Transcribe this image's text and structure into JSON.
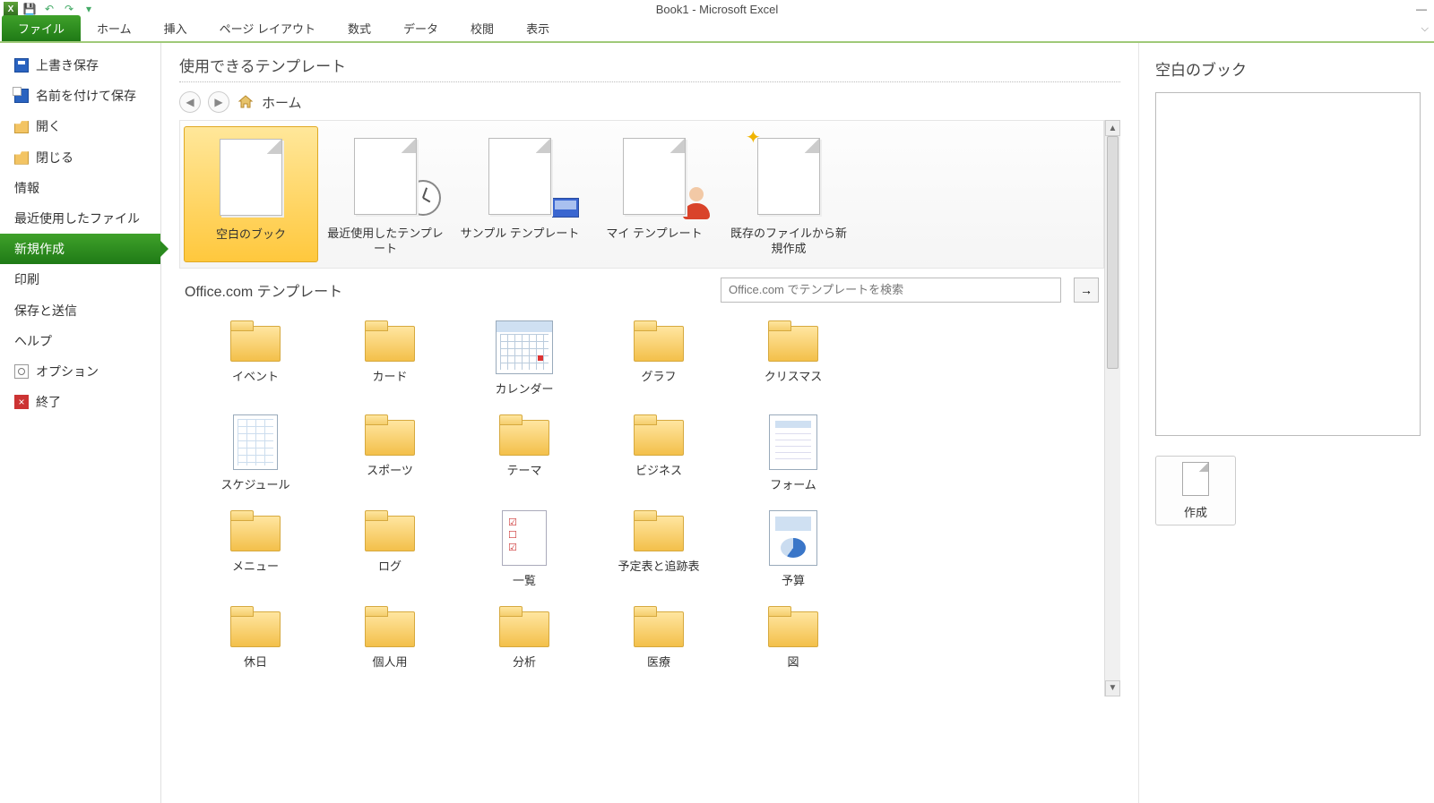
{
  "window": {
    "title": "Book1 - Microsoft Excel"
  },
  "ribbon": {
    "file": "ファイル",
    "tabs": [
      "ホーム",
      "挿入",
      "ページ レイアウト",
      "数式",
      "データ",
      "校閲",
      "表示"
    ]
  },
  "sidebar": {
    "items": [
      {
        "label": "上書き保存",
        "icon": "save"
      },
      {
        "label": "名前を付けて保存",
        "icon": "saveas"
      },
      {
        "label": "開く",
        "icon": "open"
      },
      {
        "label": "閉じる",
        "icon": "close"
      },
      {
        "label": "情報"
      },
      {
        "label": "最近使用したファイル"
      },
      {
        "label": "新規作成",
        "selected": true
      },
      {
        "label": "印刷"
      },
      {
        "label": "保存と送信"
      },
      {
        "label": "ヘルプ"
      },
      {
        "label": "オプション",
        "icon": "opt"
      },
      {
        "label": "終了",
        "icon": "exit"
      }
    ]
  },
  "center": {
    "heading": "使用できるテンプレート",
    "breadcrumb": "ホーム",
    "templates": [
      {
        "label": "空白のブック",
        "kind": "blank",
        "selected": true
      },
      {
        "label": "最近使用したテンプレート",
        "kind": "recent"
      },
      {
        "label": "サンプル テンプレート",
        "kind": "sample"
      },
      {
        "label": "マイ テンプレート",
        "kind": "my"
      },
      {
        "label": "既存のファイルから新規作成",
        "kind": "fromfile"
      }
    ],
    "office_section": "Office.com テンプレート",
    "search_placeholder": "Office.com でテンプレートを検索",
    "folders": [
      "イベント",
      "カード",
      "カレンダー",
      "グラフ",
      "クリスマス",
      "スケジュール",
      "スポーツ",
      "テーマ",
      "ビジネス",
      "フォーム",
      "メニュー",
      "ログ",
      "一覧",
      "予定表と追跡表",
      "予算",
      "休日",
      "個人用",
      "分析",
      "医療",
      "図"
    ],
    "special_thumbs": {
      "2": "calendar",
      "5": "sheet",
      "9": "form",
      "12": "checklist",
      "14": "budget"
    }
  },
  "right": {
    "heading": "空白のブック",
    "create": "作成"
  }
}
